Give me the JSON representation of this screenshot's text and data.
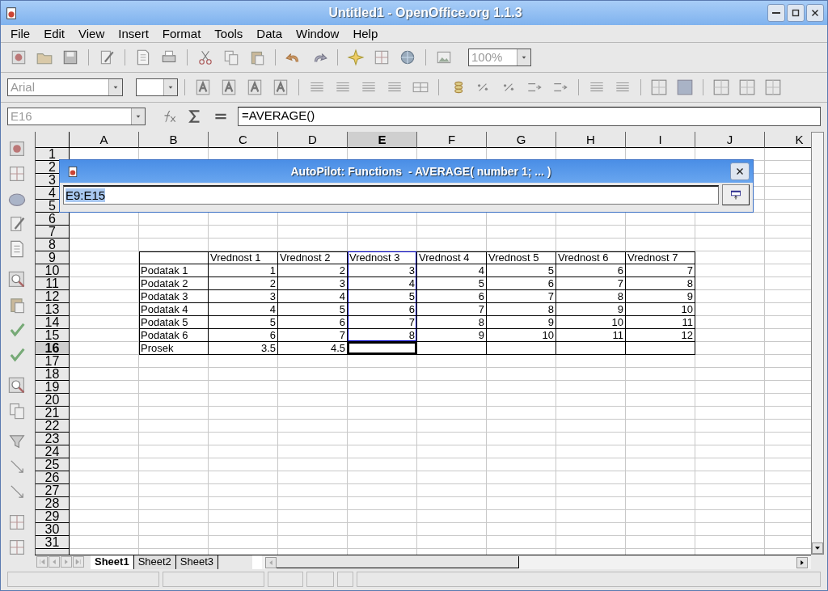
{
  "window": {
    "title": "Untitled1 - OpenOffice.org 1.1.3"
  },
  "menu": [
    {
      "label": "File"
    },
    {
      "label": "Edit"
    },
    {
      "label": "View"
    },
    {
      "label": "Insert"
    },
    {
      "label": "Format"
    },
    {
      "label": "Tools"
    },
    {
      "label": "Data"
    },
    {
      "label": "Window"
    },
    {
      "label": "Help"
    }
  ],
  "standard_toolbar": {
    "zoom": "100%"
  },
  "formatting_toolbar": {
    "font_name": "Arial"
  },
  "formula_bar": {
    "cell_reference": "E16",
    "formula": "=AVERAGE()"
  },
  "dialog": {
    "title": "AutoPilot: Functions  - AVERAGE( number 1; ... )",
    "value": "E9:E15",
    "text_selected": true
  },
  "sheet": {
    "columns": [
      {
        "label": "A",
        "selected": false
      },
      {
        "label": "B",
        "selected": false
      },
      {
        "label": "C",
        "selected": false
      },
      {
        "label": "D",
        "selected": false
      },
      {
        "label": "E",
        "selected": true
      },
      {
        "label": "F",
        "selected": false
      },
      {
        "label": "G",
        "selected": false
      },
      {
        "label": "H",
        "selected": false
      },
      {
        "label": "I",
        "selected": false
      },
      {
        "label": "J",
        "selected": false
      },
      {
        "label": "K",
        "selected": false
      }
    ],
    "rows": [
      {
        "label": "1",
        "selected": false
      },
      {
        "label": "2",
        "selected": false
      },
      {
        "label": "3",
        "selected": false
      },
      {
        "label": "4",
        "selected": false
      },
      {
        "label": "5",
        "selected": false
      },
      {
        "label": "6",
        "selected": false
      },
      {
        "label": "7",
        "selected": false
      },
      {
        "label": "8",
        "selected": false
      },
      {
        "label": "9",
        "selected": false
      },
      {
        "label": "10",
        "selected": false
      },
      {
        "label": "11",
        "selected": false
      },
      {
        "label": "12",
        "selected": false
      },
      {
        "label": "13",
        "selected": false
      },
      {
        "label": "14",
        "selected": false
      },
      {
        "label": "15",
        "selected": false
      },
      {
        "label": "16",
        "selected": true
      },
      {
        "label": "17",
        "selected": false
      },
      {
        "label": "18",
        "selected": false
      },
      {
        "label": "19",
        "selected": false
      },
      {
        "label": "20",
        "selected": false
      },
      {
        "label": "21",
        "selected": false
      },
      {
        "label": "22",
        "selected": false
      },
      {
        "label": "23",
        "selected": false
      },
      {
        "label": "24",
        "selected": false
      },
      {
        "label": "25",
        "selected": false
      },
      {
        "label": "26",
        "selected": false
      },
      {
        "label": "27",
        "selected": false
      },
      {
        "label": "28",
        "selected": false
      },
      {
        "label": "29",
        "selected": false
      },
      {
        "label": "30",
        "selected": false
      },
      {
        "label": "31",
        "selected": false
      }
    ]
  },
  "table": {
    "columns": [
      {
        "label": "Vrednost 1",
        "in_range": false
      },
      {
        "label": "Vrednost 2",
        "in_range": false
      },
      {
        "label": "Vrednost 3",
        "in_range": true
      },
      {
        "label": "Vrednost 4",
        "in_range": false
      },
      {
        "label": "Vrednost 5",
        "in_range": false
      },
      {
        "label": "Vrednost 6",
        "in_range": false
      },
      {
        "label": "Vrednost 7",
        "in_range": false
      }
    ],
    "rows": [
      {
        "label": "Podatak 1",
        "values": [
          "1",
          "2",
          "3",
          "4",
          "5",
          "6",
          "7"
        ]
      },
      {
        "label": "Podatak 2",
        "values": [
          "2",
          "3",
          "4",
          "5",
          "6",
          "7",
          "8"
        ]
      },
      {
        "label": "Podatak 3",
        "values": [
          "3",
          "4",
          "5",
          "6",
          "7",
          "8",
          "9"
        ]
      },
      {
        "label": "Podatak 4",
        "values": [
          "4",
          "5",
          "6",
          "7",
          "8",
          "9",
          "10"
        ]
      },
      {
        "label": "Podatak 5",
        "values": [
          "5",
          "6",
          "7",
          "8",
          "9",
          "10",
          "11"
        ]
      },
      {
        "label": "Podatak 6",
        "values": [
          "6",
          "7",
          "8",
          "9",
          "10",
          "11",
          "12"
        ]
      }
    ],
    "summary": {
      "label": "Prosek",
      "values": [
        "3.5",
        "4.5"
      ]
    }
  },
  "sheet_tabs": [
    {
      "label": "Sheet1",
      "selected": true
    },
    {
      "label": "Sheet2",
      "selected": false
    },
    {
      "label": "Sheet3",
      "selected": false
    }
  ]
}
